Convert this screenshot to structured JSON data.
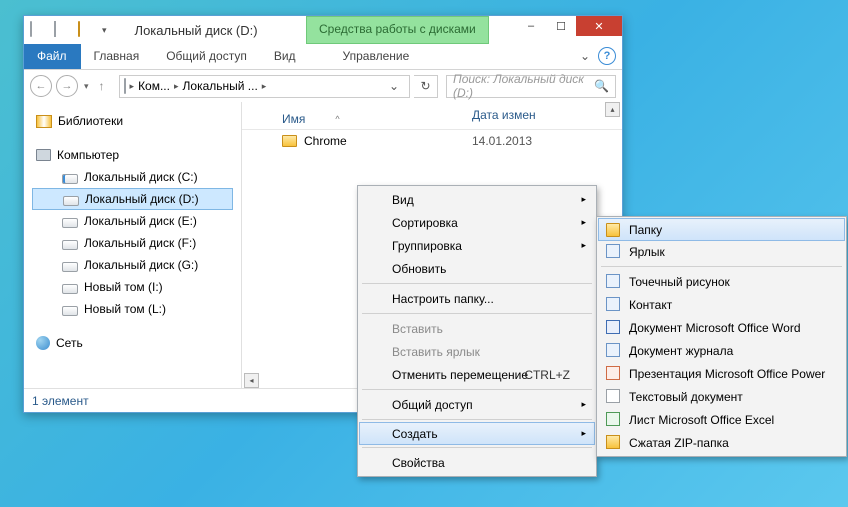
{
  "window": {
    "title": "Локальный диск (D:)",
    "tools_tab": "Средства работы с дисками",
    "win_btns": {
      "min": "–",
      "max": "☐",
      "close": "✕"
    }
  },
  "ribbon": {
    "file": "Файл",
    "home": "Главная",
    "share": "Общий доступ",
    "view": "Вид",
    "manage": "Управление",
    "help": "?",
    "collapse": "⌄"
  },
  "nav": {
    "back": "←",
    "forward": "→",
    "dropdown": "▾",
    "crumb1": "Ком...",
    "crumb2": "Локальный ...",
    "refresh": "↻",
    "search_placeholder": "Поиск: Локальный диск (D:)",
    "search_icon": "🔍"
  },
  "tree": {
    "libraries": "Библиотеки",
    "computer": "Компьютер",
    "drive_c": "Локальный диск (C:)",
    "drive_d": "Локальный диск (D:)",
    "drive_e": "Локальный диск (E:)",
    "drive_f": "Локальный диск (F:)",
    "drive_g": "Локальный диск (G:)",
    "vol_i": "Новый том (I:)",
    "vol_l": "Новый том (L:)",
    "network": "Сеть"
  },
  "content": {
    "col_name": "Имя",
    "col_date": "Дата измен",
    "sort_indicator": "^",
    "rows": [
      {
        "name": "Chrome",
        "date": "14.01.2013"
      }
    ]
  },
  "status": {
    "text": "1 элемент"
  },
  "context1": {
    "view": "Вид",
    "sort": "Сортировка",
    "group": "Группировка",
    "refresh": "Обновить",
    "customize": "Настроить папку...",
    "paste": "Вставить",
    "paste_shortcut": "Вставить ярлык",
    "undo_move": "Отменить перемещение",
    "undo_key": "CTRL+Z",
    "share": "Общий доступ",
    "create": "Создать",
    "properties": "Свойства"
  },
  "context2": {
    "folder": "Папку",
    "shortcut": "Ярлык",
    "bitmap": "Точечный рисунок",
    "contact": "Контакт",
    "word": "Документ Microsoft Office Word",
    "journal": "Документ журнала",
    "ppt": "Презентация Microsoft Office Power",
    "txt": "Текстовый документ",
    "excel": "Лист Microsoft Office Excel",
    "zip": "Сжатая ZIP-папка"
  }
}
